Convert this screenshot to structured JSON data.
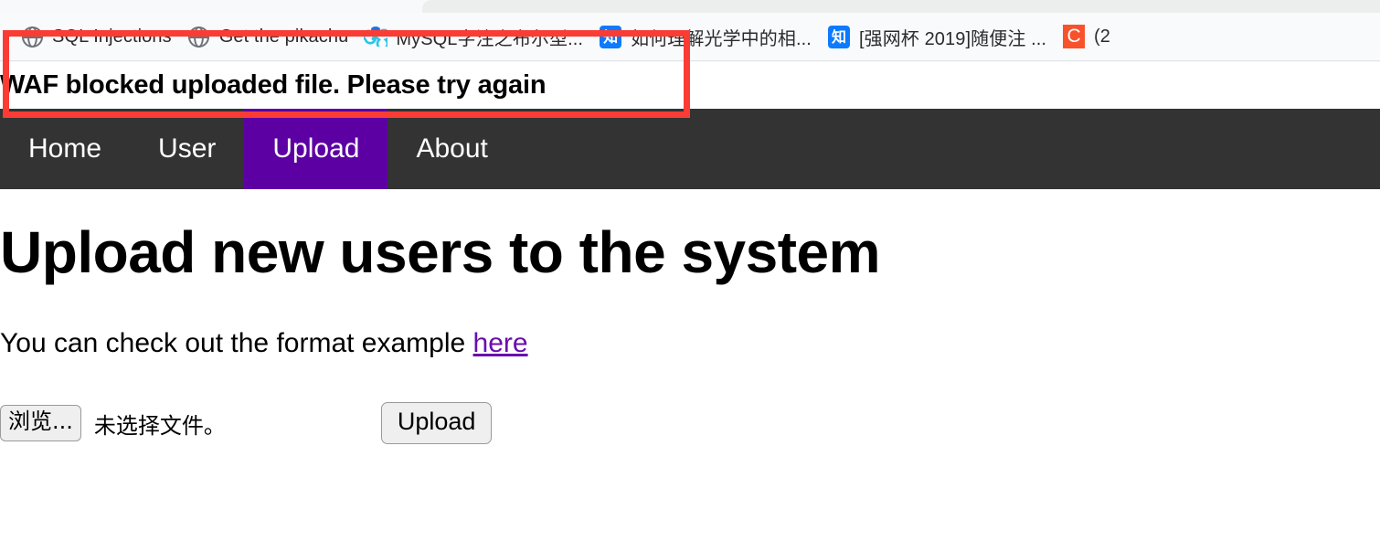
{
  "browser": {
    "bookmarks": [
      {
        "label": "SQL Injections",
        "icon": "globe-icon"
      },
      {
        "label": "Get the pikachu",
        "icon": "globe-icon"
      },
      {
        "label": "MySQL字注之布尔型...",
        "icon": "csdn-icon"
      },
      {
        "label": "如何理解光学中的相...",
        "icon": "zhihu-icon",
        "icon_glyph": "知"
      },
      {
        "label": "[强网杯 2019]随便注 ...",
        "icon": "zhihu-icon",
        "icon_glyph": "知"
      },
      {
        "label": "(2",
        "icon": "letterbox-icon",
        "icon_glyph": "C"
      }
    ]
  },
  "page": {
    "flash_message": "WAF blocked uploaded file. Please try again",
    "nav": {
      "items": [
        {
          "label": "Home",
          "active": false
        },
        {
          "label": "User",
          "active": false
        },
        {
          "label": "Upload",
          "active": true
        },
        {
          "label": "About",
          "active": false
        }
      ]
    },
    "title": "Upload new users to the system",
    "intro": {
      "text_before_link": "You can check out the format example ",
      "link_label": "here"
    },
    "form": {
      "browse_button_label": "浏览...",
      "file_status_text": "未选择文件。",
      "submit_button_label": "Upload"
    }
  },
  "colors": {
    "navbar_background": "#333333",
    "active_nav": "#5c00a3",
    "link": "#6a0dad",
    "annotation": "#fa3c35",
    "flash_text": "#000000"
  }
}
